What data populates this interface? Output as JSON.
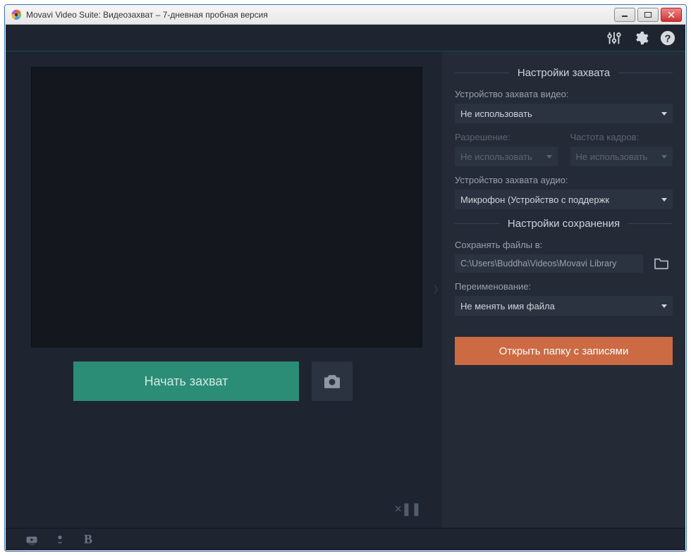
{
  "window": {
    "title": "Movavi Video Suite: Видеозахват – 7-дневная пробная версия"
  },
  "capture_settings": {
    "heading": "Настройки захвата",
    "video_device_label": "Устройство захвата видео:",
    "video_device_value": "Не использовать",
    "resolution_label": "Разрешение:",
    "resolution_value": "Не использовать",
    "fps_label": "Частота кадров:",
    "fps_value": "Не использовать",
    "audio_device_label": "Устройство захвата аудио:",
    "audio_device_value": "Микрофон (Устройство с поддержк"
  },
  "save_settings": {
    "heading": "Настройки сохранения",
    "save_to_label": "Сохранять файлы в:",
    "save_to_path": "C:\\Users\\Buddha\\Videos\\Movavi Library",
    "rename_label": "Переименование:",
    "rename_value": "Не менять имя файла",
    "open_folder_label": "Открыть папку с записями"
  },
  "actions": {
    "start_capture": "Начать захват"
  }
}
